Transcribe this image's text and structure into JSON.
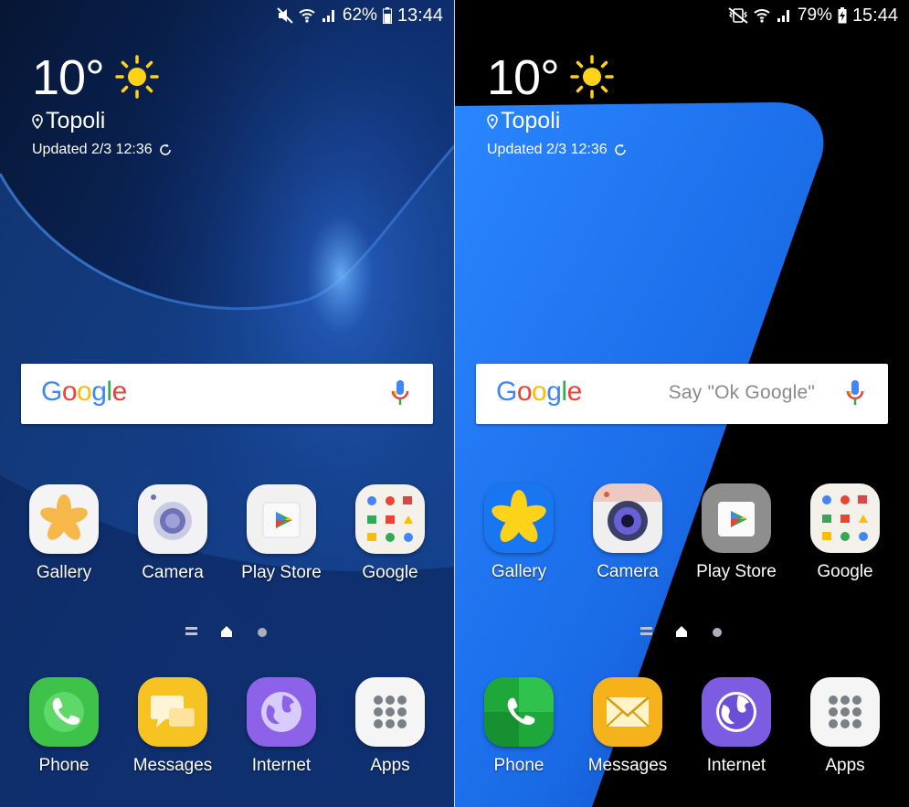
{
  "screens": [
    {
      "id": "left",
      "status": {
        "battery": "62%",
        "time": "13:44"
      },
      "weather": {
        "temperature": "10°",
        "location": "Topoli",
        "updated": "Updated 2/3  12:36"
      },
      "search": {
        "logo": "Google",
        "placeholder": ""
      },
      "apps": [
        {
          "label": "Gallery",
          "icon": "gallery-icon"
        },
        {
          "label": "Camera",
          "icon": "camera-icon"
        },
        {
          "label": "Play Store",
          "icon": "play-store-icon"
        },
        {
          "label": "Google",
          "icon": "google-folder-icon"
        }
      ],
      "dock": [
        {
          "label": "Phone",
          "icon": "phone-icon"
        },
        {
          "label": "Messages",
          "icon": "messages-icon"
        },
        {
          "label": "Internet",
          "icon": "internet-icon"
        },
        {
          "label": "Apps",
          "icon": "apps-grid-icon"
        }
      ]
    },
    {
      "id": "right",
      "status": {
        "battery": "79%",
        "time": "15:44"
      },
      "weather": {
        "temperature": "10°",
        "location": "Topoli",
        "updated": "Updated 2/3 12:36"
      },
      "search": {
        "logo": "Google",
        "placeholder": "Say \"Ok Google\""
      },
      "apps": [
        {
          "label": "Gallery",
          "icon": "gallery-icon"
        },
        {
          "label": "Camera",
          "icon": "camera-icon"
        },
        {
          "label": "Play Store",
          "icon": "play-store-icon"
        },
        {
          "label": "Google",
          "icon": "google-folder-icon"
        }
      ],
      "dock": [
        {
          "label": "Phone",
          "icon": "phone-icon"
        },
        {
          "label": "Messages",
          "icon": "messages-icon"
        },
        {
          "label": "Internet",
          "icon": "internet-icon"
        },
        {
          "label": "Apps",
          "icon": "apps-grid-icon"
        }
      ]
    }
  ],
  "colors": {
    "google_blue": "#4285F4",
    "google_red": "#EA4335",
    "google_yellow": "#FBBC05",
    "google_green": "#34A853",
    "wallpaper_left": "#0c2a66",
    "wallpaper_right_accent": "#1e74f0",
    "sun": "#ffd21a"
  }
}
